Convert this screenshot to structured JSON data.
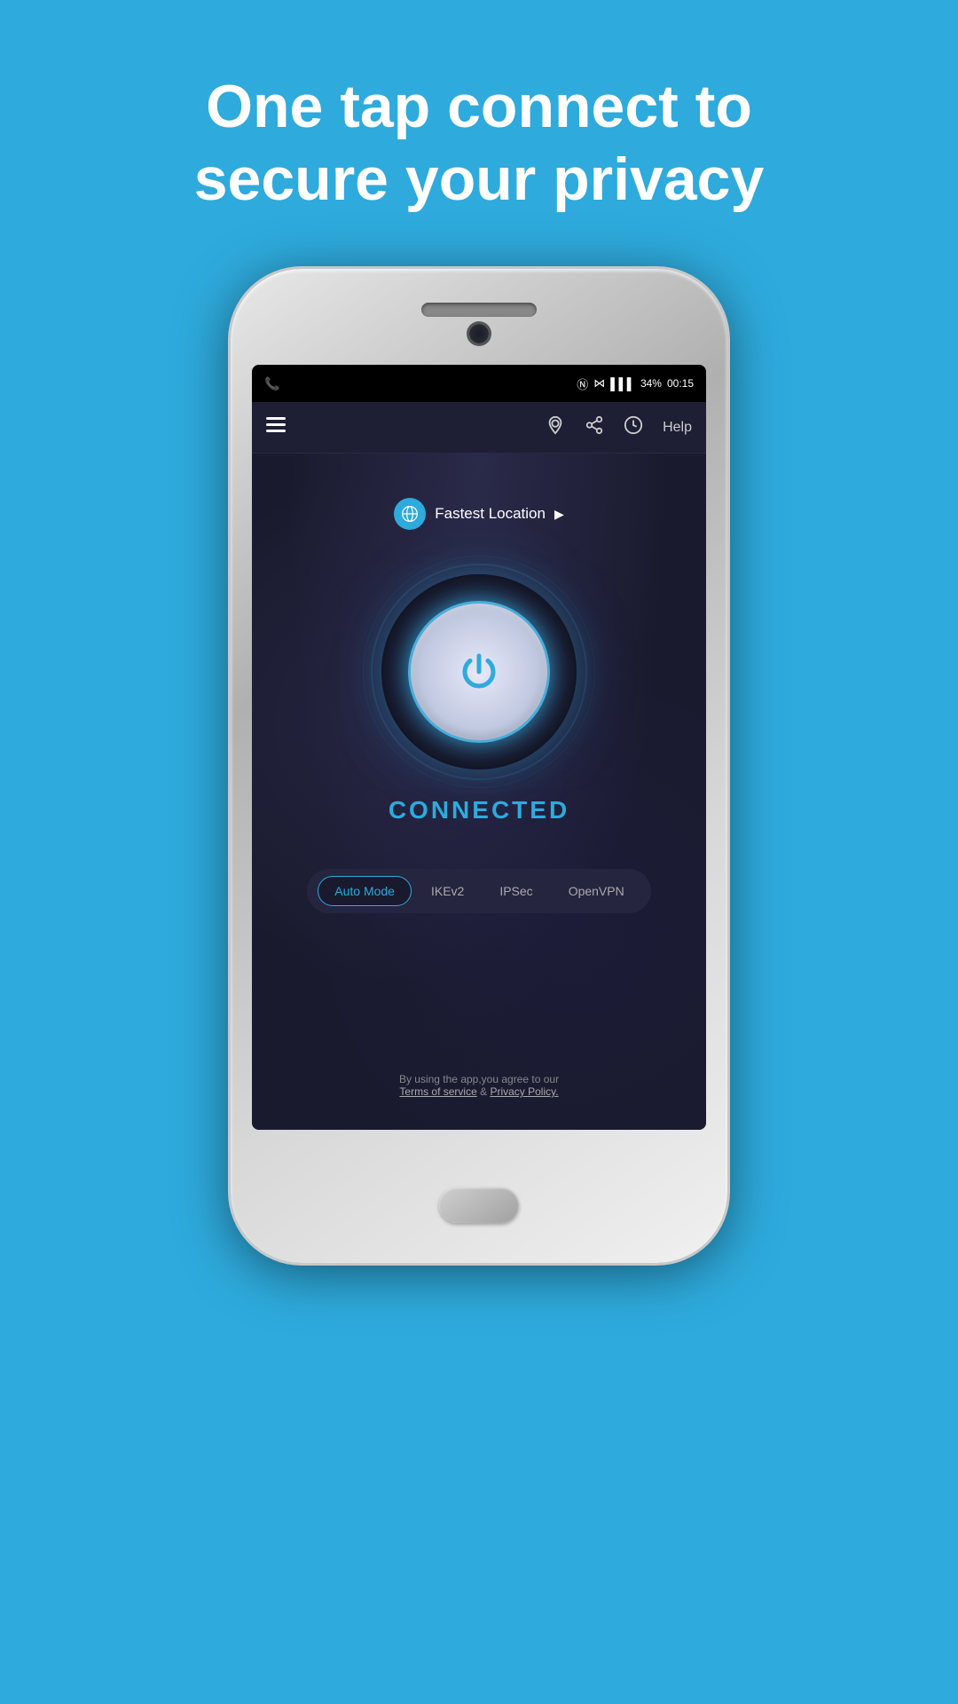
{
  "page": {
    "background_color": "#2eaadc",
    "headline_line1": "One tap connect to",
    "headline_line2": "secure your privacy"
  },
  "status_bar": {
    "phone_icon": "📞",
    "nfc_icon": "N",
    "wifi_icon": "WiFi",
    "signal_icon": "▌▌▌",
    "battery_text": "34%",
    "time": "00:15"
  },
  "toolbar": {
    "menu_icon": "menu-icon",
    "location_icon": "location-icon",
    "share_icon": "share-icon",
    "speed_icon": "speed-icon",
    "help_label": "Help"
  },
  "app": {
    "location_label": "Fastest Location",
    "location_arrow": "▶",
    "connection_status": "CONNECTED",
    "protocol_tabs": [
      {
        "id": "auto",
        "label": "Auto Mode",
        "active": true
      },
      {
        "id": "ikev2",
        "label": "IKEv2",
        "active": false
      },
      {
        "id": "ipsec",
        "label": "IPSec",
        "active": false
      },
      {
        "id": "openvpn",
        "label": "OpenVPN",
        "active": false
      }
    ],
    "footer": {
      "agreement_text": "By using the app,you agree to our",
      "terms_label": "Terms of service",
      "separator": "&",
      "privacy_label": "Privacy Policy."
    }
  }
}
